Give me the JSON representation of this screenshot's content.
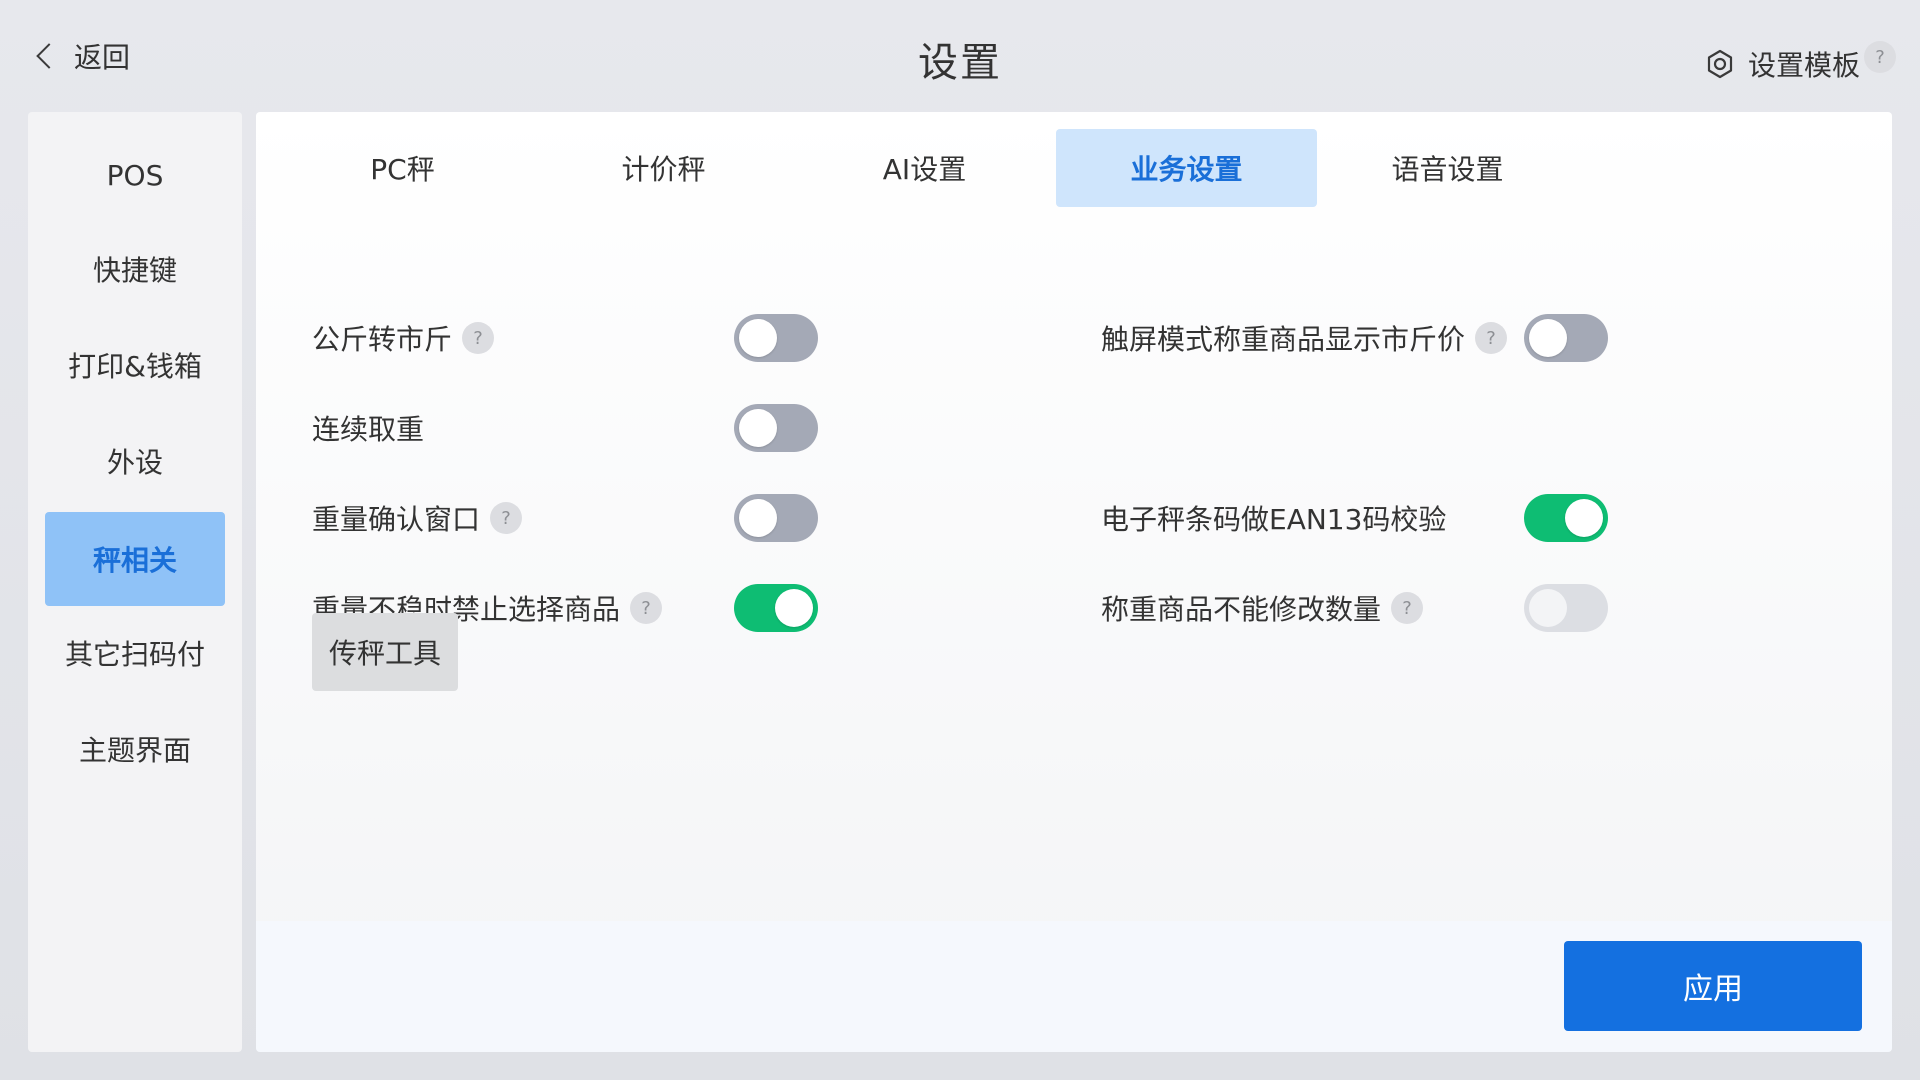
{
  "header": {
    "back_label": "返回",
    "title": "设置",
    "template_label": "设置模板",
    "template_help": "?"
  },
  "sidebar": {
    "items": [
      {
        "label": "POS"
      },
      {
        "label": "快捷键"
      },
      {
        "label": "打印&钱箱"
      },
      {
        "label": "外设"
      },
      {
        "label": "秤相关",
        "active": true
      },
      {
        "label": "其它扫码付"
      },
      {
        "label": "主题界面"
      }
    ]
  },
  "tabs": [
    {
      "label": "PC秤"
    },
    {
      "label": "计价秤"
    },
    {
      "label": "AI设置"
    },
    {
      "label": "业务设置",
      "active": true
    },
    {
      "label": "语音设置"
    }
  ],
  "settings": {
    "left": [
      {
        "label": "公斤转市斤",
        "help": "?",
        "state": "off"
      },
      {
        "label": "连续取重",
        "state": "off"
      },
      {
        "label": "重量确认窗口",
        "help": "?",
        "state": "off"
      },
      {
        "label": "重量不稳时禁止选择商品",
        "help": "?",
        "state": "on"
      }
    ],
    "right": [
      {
        "label": "触屏模式称重商品显示市斤价",
        "help": "?",
        "state": "off"
      },
      {
        "label": "电子秤条码做EAN13码校验",
        "state": "on"
      },
      {
        "label": "称重商品不能修改数量",
        "help": "?",
        "state": "disabled"
      }
    ]
  },
  "tool_button_label": "传秤工具",
  "apply_label": "应用",
  "colors": {
    "accent": "#1470e0",
    "active_tab_bg": "#cfe5fc",
    "active_sidebar_bg": "#8fc2f7",
    "toggle_on": "#0ebd73",
    "toggle_off": "#a4a9b6"
  },
  "icons": {
    "back": "chevron-left-icon",
    "template": "hexagon-gear-icon",
    "help": "question-mark-icon"
  }
}
